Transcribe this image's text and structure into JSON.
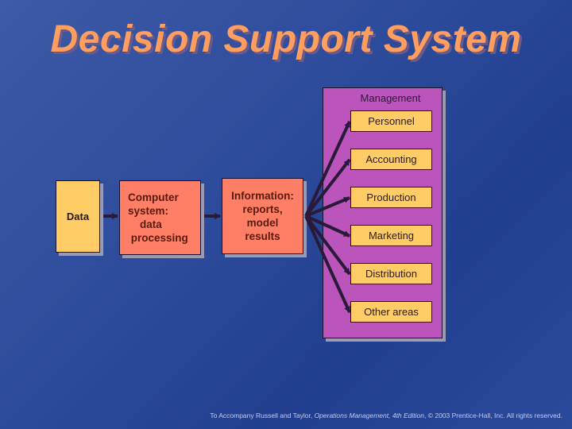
{
  "title": "Decision Support System",
  "flow": {
    "data_label": "Data",
    "computer_label": "Computer\nsystem:\n    data\n processing",
    "information_label": "Information:\nreports,\nmodel\nresults"
  },
  "management": {
    "label": "Management",
    "areas": [
      "Personnel",
      "Accounting",
      "Production",
      "Marketing",
      "Distribution",
      "Other areas"
    ]
  },
  "colors": {
    "background": "#2c4a9a",
    "title": "#ff9e5e",
    "data_box": "#ffcc66",
    "process_box": "#ff7f66",
    "management_panel": "#bb55bb",
    "area_box": "#ffcc66",
    "arrow": "#2a1a3a"
  },
  "footer": {
    "prefix": "To Accompany Russell and Taylor, ",
    "book": "Operations Management, 4th Edition",
    "suffix": ",  © 2003 Prentice-Hall, Inc. All rights reserved."
  }
}
